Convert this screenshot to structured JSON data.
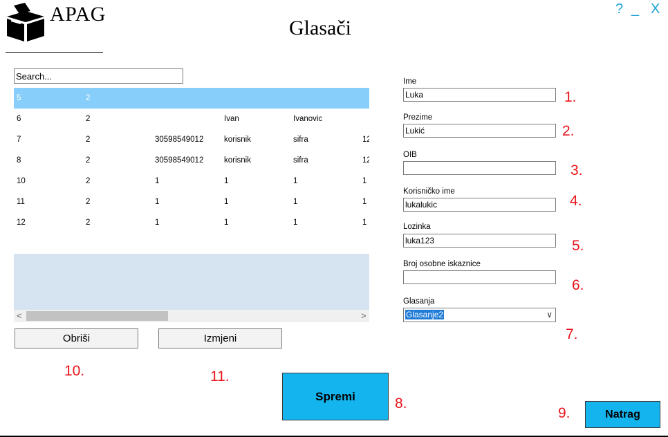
{
  "header": {
    "logo_text": "APAG",
    "page_title": "Glasači",
    "help_label": "?",
    "minimize_label": "_",
    "close_label": "X"
  },
  "search": {
    "placeholder": "Search..."
  },
  "grid": {
    "rows": [
      [
        "5",
        "2",
        "",
        "",
        "",
        ""
      ],
      [
        "6",
        "2",
        "",
        "Ivan",
        "Ivanovic",
        ""
      ],
      [
        "7",
        "2",
        "30598549012",
        "korisnik",
        "sifra",
        "12"
      ],
      [
        "8",
        "2",
        "30598549012",
        "korisnik",
        "sifra",
        "12"
      ],
      [
        "10",
        "2",
        "1",
        "1",
        "1",
        "1"
      ],
      [
        "11",
        "2",
        "1",
        "1",
        "1",
        "1"
      ],
      [
        "12",
        "2",
        "1",
        "1",
        "1",
        "1"
      ]
    ],
    "scroll_left": "<",
    "scroll_right": ">"
  },
  "actions": {
    "delete_label": "Obriši",
    "edit_label": "Izmjeni",
    "save_label": "Spremi",
    "back_label": "Natrag"
  },
  "form": {
    "ime_label": "Ime",
    "ime_value": "Luka",
    "prezime_label": "Prezime",
    "prezime_value": "Lukić",
    "oib_label": "OIB",
    "oib_value": "",
    "korisnicko_label": "Korisničko ime",
    "korisnicko_value": "lukalukic",
    "lozinka_label": "Lozinka",
    "lozinka_value": "luka123",
    "broj_label": "Broj osobne iskaznice",
    "broj_value": "",
    "glasanja_label": "Glasanja",
    "glasanja_value": "Glasanje2"
  },
  "annotations": {
    "n1": "1.",
    "n2": "2.",
    "n3": "3.",
    "n4": "4.",
    "n5": "5.",
    "n6": "6.",
    "n7": "7.",
    "n8": "8.",
    "n9": "9.",
    "n10": "10.",
    "n11": "11."
  }
}
